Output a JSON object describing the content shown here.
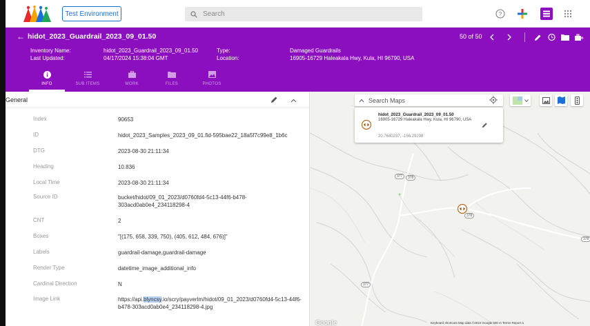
{
  "topbar": {
    "environment_label": "Test Environment",
    "search_placeholder": "Search"
  },
  "header": {
    "title": "hidot_2023_Guardrail_2023_09_01.50",
    "inventory_name_label": "Inventory Name:",
    "inventory_name": "hidot_2023_Guardrail_2023_09_01.50",
    "last_updated_label": "Last Updated:",
    "last_updated": "04/17/2024 15:38:04 GMT",
    "type_label": "Type:",
    "type": "Damaged Guardrails",
    "location_label": "Location:",
    "location": "16905-16729 Haleakala Hwy, Kula, HI 96790, USA",
    "pager": "50 of 50",
    "tabs": [
      {
        "label": "INFO",
        "icon": "info-icon"
      },
      {
        "label": "SUB ITEMS",
        "icon": "list-icon"
      },
      {
        "label": "WORK",
        "icon": "briefcase-icon"
      },
      {
        "label": "FILES",
        "icon": "folder-icon"
      },
      {
        "label": "PHOTOS",
        "icon": "image-icon"
      }
    ]
  },
  "general": {
    "title": "General",
    "rows": [
      {
        "key": "Index",
        "value": "90653"
      },
      {
        "key": "ID",
        "value": "hidot_2023_Samples_2023_09_01.fid-595bae22_18a5f7c99e8_1b6c"
      },
      {
        "key": "DTG",
        "value": "2023-08-30 21:11:34"
      },
      {
        "key": "Heading",
        "value": "10.836"
      },
      {
        "key": "Local Time",
        "value": "2023-08-30 21:11:34"
      },
      {
        "key": "Source ID",
        "value": "bucket/hidot/09_01_2023/d0760fd4-5c13-44f6-b478-303acd0ab0e4_234118298-4"
      },
      {
        "key": "CNT",
        "value": "2"
      },
      {
        "key": "Boxes",
        "value": "\"[(175, 658, 339, 750), (405, 612, 484, 676)]\""
      },
      {
        "key": "Labels",
        "value": "guardrail-damage,guardrail-damage"
      },
      {
        "key": "Render Type",
        "value": "datetime_image_additional_info"
      },
      {
        "key": "Cardinal Direction",
        "value": "N"
      },
      {
        "key": "Image Link",
        "value_prefix": "https://api.",
        "value_highlight": "blyncsy",
        "value_suffix": ".io/scry/payverlm/hidot/09_01_2023/d0760fd4-5c13-44f6-b478-303acd0ab0e4_234118298-4.jpg"
      }
    ]
  },
  "map": {
    "search_placeholder": "Search Maps",
    "popup": {
      "title": "hidot_2023_Guardrail_2023_09_01.50",
      "address": "16905-16729 Haleakala Hwy, Kula, HI 96790, USA",
      "coords": "20.7640237, -156.29298"
    },
    "road_badges": [
      "377",
      "378",
      "378",
      "378",
      "377"
    ],
    "google_label": "Google",
    "footer": "Keyboard shortcuts    Map data ©2024 Google    500 m              Terms    Report a"
  },
  "colors": {
    "brand_purple": "#8b0fbf",
    "accent_blue": "#1a6fd8"
  }
}
